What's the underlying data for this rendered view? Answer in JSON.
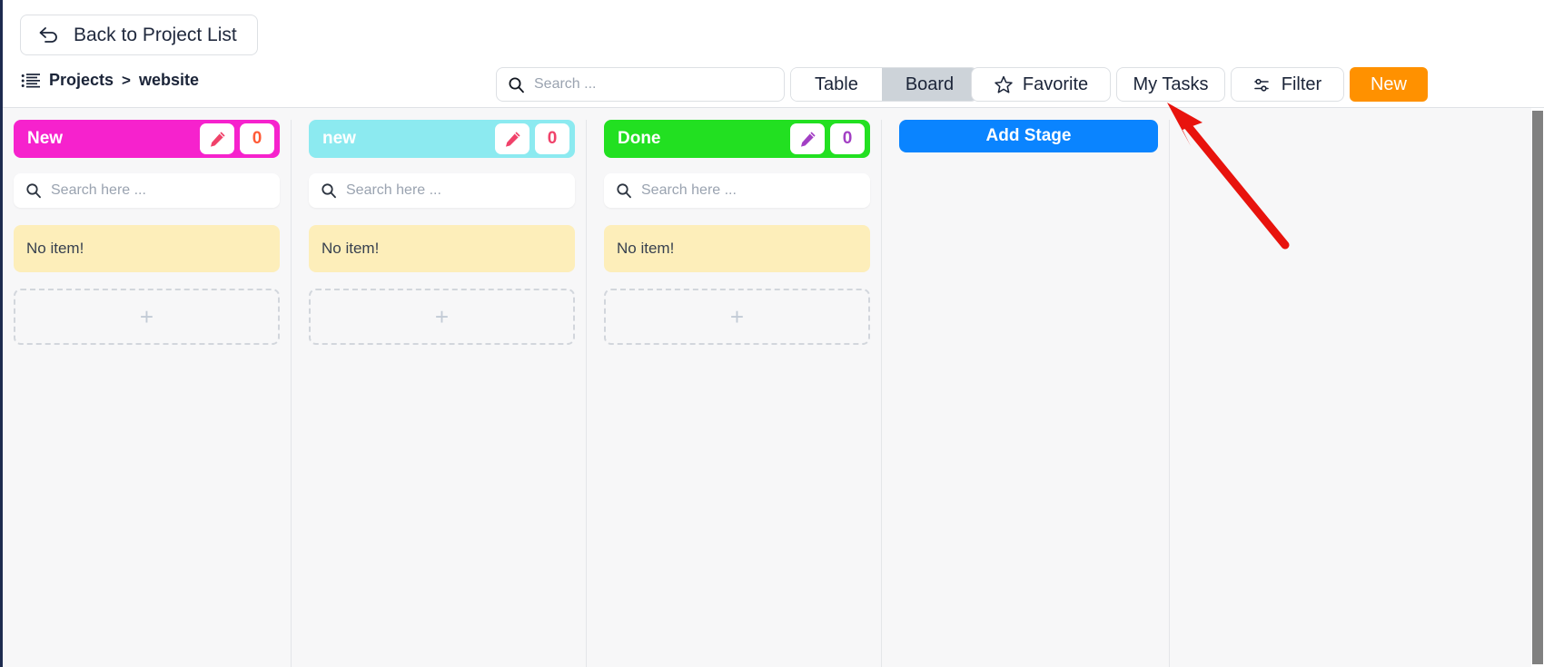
{
  "header": {
    "back_label": "Back to Project List",
    "back_icon": "undo-arrow-icon",
    "breadcrumb": {
      "icon": "list-icon",
      "root": "Projects",
      "separator": ">",
      "current": "website"
    },
    "search": {
      "placeholder": "Search ...",
      "value": "",
      "icon": "search-icon"
    },
    "view_switch": {
      "options": [
        "Table",
        "Board"
      ],
      "active": "Board"
    },
    "favorite_label": "Favorite",
    "favorite_icon": "star-icon",
    "my_tasks_label": "My Tasks",
    "filter_label": "Filter",
    "filter_icon": "filter-sliders-icon",
    "new_label": "New",
    "new_color": "#ff9100"
  },
  "board": {
    "add_stage_label": "Add Stage",
    "add_stage_color": "#0a84ff",
    "columns": [
      {
        "title": "New",
        "header_color": "#f622cd",
        "count": "0",
        "count_color": "#ff5a36",
        "pencil_color": "#f0426a",
        "edit_icon": "pencil-icon",
        "search_placeholder": "Search here ...",
        "search_value": "",
        "search_icon": "search-icon",
        "empty_text": "No item!",
        "add_icon": "plus-icon"
      },
      {
        "title": "new",
        "header_color": "#8ceaf0",
        "count": "0",
        "count_color": "#f0426a",
        "pencil_color": "#f0426a",
        "edit_icon": "pencil-icon",
        "search_placeholder": "Search here ...",
        "search_value": "",
        "search_icon": "search-icon",
        "empty_text": "No item!",
        "add_icon": "plus-icon"
      },
      {
        "title": "Done",
        "header_color": "#22e021",
        "count": "0",
        "count_color": "#a23fc4",
        "pencil_color": "#a23fc4",
        "edit_icon": "pencil-icon",
        "search_placeholder": "Search here ...",
        "search_value": "",
        "search_icon": "search-icon",
        "empty_text": "No item!",
        "add_icon": "plus-icon"
      }
    ]
  },
  "annotation": {
    "type": "arrow",
    "color": "#e8130d",
    "points_to": "My Tasks"
  }
}
